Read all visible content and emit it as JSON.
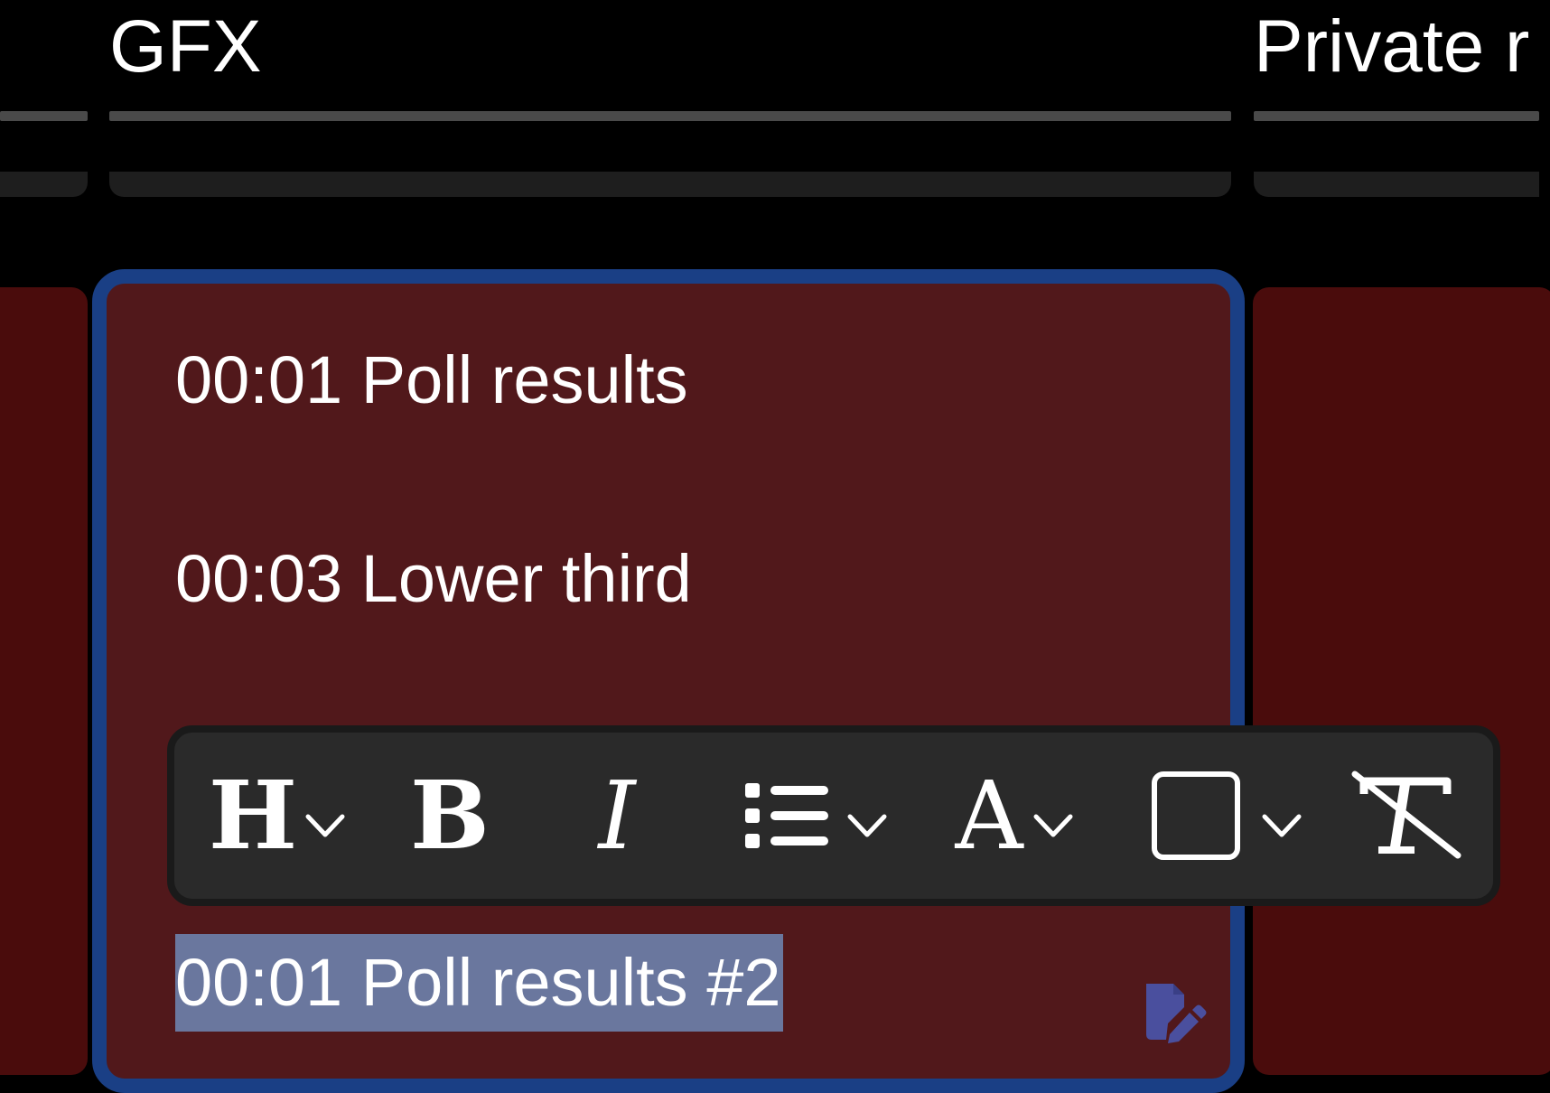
{
  "columns": {
    "gfx_title": "GFX",
    "private_title": "Private r"
  },
  "cues": [
    {
      "text": "00:01 Poll results"
    },
    {
      "text": "00:03 Lower third"
    },
    {
      "text": "00:01 Poll results #2",
      "selected": true
    }
  ],
  "toolbar": {
    "heading_label": "H",
    "bold_label": "B",
    "italic_label": "I",
    "color_label": "A",
    "icons": [
      "heading-icon",
      "bold-icon",
      "italic-icon",
      "list-icon",
      "text-color-icon",
      "background-color-icon",
      "clear-format-icon"
    ]
  },
  "colors": {
    "background": "#000000",
    "lane": "#4a0c0c",
    "active_lane": "#51181b",
    "active_border": "#1a3f85",
    "selection": "#6a779e",
    "toolbar": "#2a2a2a",
    "edit_icon": "#4a4f9e"
  }
}
